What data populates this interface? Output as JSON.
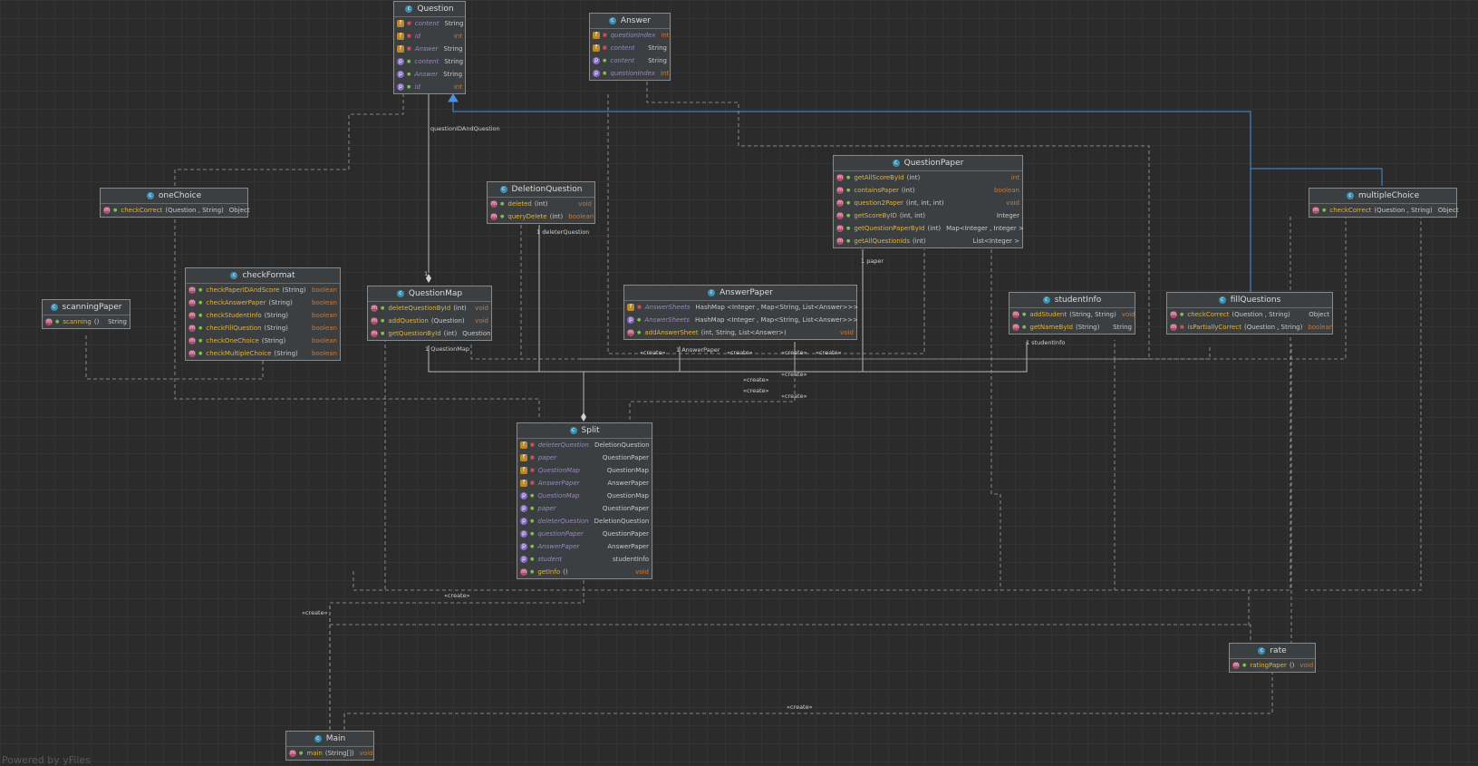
{
  "classes": {
    "question": {
      "name": "Question",
      "members": [
        {
          "kind": "f",
          "vis": "priv",
          "name": "content",
          "type": "String"
        },
        {
          "kind": "f",
          "vis": "priv",
          "name": "id",
          "type": "int"
        },
        {
          "kind": "f",
          "vis": "priv",
          "name": "Answer",
          "type": "String"
        },
        {
          "kind": "p",
          "vis": "pub",
          "name": "content",
          "type": "String"
        },
        {
          "kind": "p",
          "vis": "pub",
          "name": "Answer",
          "type": "String"
        },
        {
          "kind": "p",
          "vis": "pub",
          "name": "id",
          "type": "int"
        }
      ]
    },
    "answer": {
      "name": "Answer",
      "members": [
        {
          "kind": "f",
          "vis": "priv",
          "name": "questionIndex",
          "type": "int"
        },
        {
          "kind": "f",
          "vis": "priv",
          "name": "content",
          "type": "String"
        },
        {
          "kind": "p",
          "vis": "pub",
          "name": "content",
          "type": "String"
        },
        {
          "kind": "p",
          "vis": "pub",
          "name": "questionIndex",
          "type": "int"
        }
      ]
    },
    "onechoice": {
      "name": "oneChoice",
      "members": [
        {
          "kind": "m",
          "vis": "pub",
          "name": "checkCorrect",
          "params": "(Question , String)",
          "type": "Object"
        }
      ]
    },
    "multiplechoice": {
      "name": "multipleChoice",
      "members": [
        {
          "kind": "m",
          "vis": "pub",
          "name": "checkCorrect",
          "params": "(Question , String)",
          "type": "Object"
        }
      ]
    },
    "deletionquestion": {
      "name": "DeletionQuestion",
      "members": [
        {
          "kind": "m",
          "vis": "pub",
          "name": "deleted",
          "params": "(int)",
          "type": "void"
        },
        {
          "kind": "m",
          "vis": "pub",
          "name": "queryDelete",
          "params": "(int)",
          "type": "boolean"
        }
      ]
    },
    "questionpaper": {
      "name": "QuestionPaper",
      "members": [
        {
          "kind": "m",
          "vis": "pub",
          "name": "getAllScoreById",
          "params": "(int)",
          "type": "int"
        },
        {
          "kind": "m",
          "vis": "pub",
          "name": "containsPaper",
          "params": "(int)",
          "type": "boolean"
        },
        {
          "kind": "m",
          "vis": "pub",
          "name": "question2Paper",
          "params": "(int, int, int)",
          "type": "void"
        },
        {
          "kind": "m",
          "vis": "pub",
          "name": "getScoreByID",
          "params": "(int, int)",
          "type": "Integer"
        },
        {
          "kind": "m",
          "vis": "pub",
          "name": "getQuestionPaperById",
          "params": "(int)",
          "type": "Map<Integer , Integer >"
        },
        {
          "kind": "m",
          "vis": "pub",
          "name": "getAllQuestionIds",
          "params": "(int)",
          "type": "List<Integer >"
        }
      ]
    },
    "scanningpaper": {
      "name": "scanningPaper",
      "members": [
        {
          "kind": "m",
          "vis": "pub",
          "name": "scanning",
          "params": "()",
          "type": "String"
        }
      ]
    },
    "checkformat": {
      "name": "checkFormat",
      "members": [
        {
          "kind": "m",
          "vis": "pub",
          "name": "checkPaperIDAndScore",
          "params": "(String)",
          "type": "boolean"
        },
        {
          "kind": "m",
          "vis": "pub",
          "name": "checkAnswerPaper",
          "params": "(String)",
          "type": "boolean"
        },
        {
          "kind": "m",
          "vis": "pub",
          "name": "checkStudentInfo",
          "params": "(String)",
          "type": "boolean"
        },
        {
          "kind": "m",
          "vis": "pub",
          "name": "checkFillQuestion",
          "params": "(String)",
          "type": "boolean"
        },
        {
          "kind": "m",
          "vis": "pub",
          "name": "checkOneChoice",
          "params": "(String)",
          "type": "boolean"
        },
        {
          "kind": "m",
          "vis": "pub",
          "name": "checkMultipleChoice",
          "params": "(String)",
          "type": "boolean"
        }
      ]
    },
    "questionmap": {
      "name": "QuestionMap",
      "members": [
        {
          "kind": "m",
          "vis": "pub",
          "name": "deleteQuestionById",
          "params": "(int)",
          "type": "void"
        },
        {
          "kind": "m",
          "vis": "pub",
          "name": "addQuestion",
          "params": "(Question)",
          "type": "void"
        },
        {
          "kind": "m",
          "vis": "pub",
          "name": "getQuestionById",
          "params": "(int)",
          "type": "Question"
        }
      ]
    },
    "answerpaper": {
      "name": "AnswerPaper",
      "members": [
        {
          "kind": "f",
          "vis": "priv",
          "name": "AnswerSheets",
          "params": "",
          "type": "HashMap <Integer , Map<String, List<Answer>>>"
        },
        {
          "kind": "p",
          "vis": "pub",
          "name": "AnswerSheets",
          "params": "",
          "type": "HashMap <Integer , Map<String, List<Answer>>>"
        },
        {
          "kind": "m",
          "vis": "pub",
          "name": "addAnswerSheet",
          "params": "(int, String, List<Answer>)",
          "type": "void"
        }
      ]
    },
    "studentinfo": {
      "name": "studentInfo",
      "members": [
        {
          "kind": "m",
          "vis": "pub",
          "name": "addStudent",
          "params": "(String, String)",
          "type": "void"
        },
        {
          "kind": "m",
          "vis": "pub",
          "name": "getNameById",
          "params": "(String)",
          "type": "String"
        }
      ]
    },
    "fillquestions": {
      "name": "fillQuestions",
      "members": [
        {
          "kind": "m",
          "vis": "pub",
          "name": "checkCorrect",
          "params": "(Question , String)",
          "type": "Object"
        },
        {
          "kind": "m",
          "vis": "priv",
          "name": "isPartiallyCorrect",
          "params": "(Question , String)",
          "type": "boolean"
        }
      ]
    },
    "split": {
      "name": "Split",
      "members": [
        {
          "kind": "f",
          "vis": "priv",
          "name": "deleterQuestion",
          "type": "DeletionQuestion"
        },
        {
          "kind": "f",
          "vis": "priv",
          "name": "paper",
          "type": "QuestionPaper"
        },
        {
          "kind": "f",
          "vis": "priv",
          "name": "QuestionMap",
          "type": "QuestionMap"
        },
        {
          "kind": "f",
          "vis": "priv",
          "name": "AnswerPaper",
          "type": "AnswerPaper"
        },
        {
          "kind": "p",
          "vis": "pub",
          "name": "QuestionMap",
          "type": "QuestionMap"
        },
        {
          "kind": "p",
          "vis": "pub",
          "name": "paper",
          "type": "QuestionPaper"
        },
        {
          "kind": "p",
          "vis": "pub",
          "name": "deleterQuestion",
          "type": "DeletionQuestion"
        },
        {
          "kind": "p",
          "vis": "pub",
          "name": "questionPaper",
          "type": "QuestionPaper"
        },
        {
          "kind": "p",
          "vis": "pub",
          "name": "AnswerPaper",
          "type": "AnswerPaper"
        },
        {
          "kind": "p",
          "vis": "pub",
          "name": "student",
          "type": "studentInfo"
        },
        {
          "kind": "m",
          "vis": "pub",
          "name": "getInfo",
          "params": "()",
          "type": "void"
        }
      ]
    },
    "rate": {
      "name": "rate",
      "members": [
        {
          "kind": "m",
          "vis": "pub",
          "name": "ratingPaper",
          "params": "()",
          "type": "void"
        }
      ]
    },
    "main": {
      "name": "Main",
      "members": [
        {
          "kind": "m",
          "vis": "pub",
          "name": "main",
          "params": "(String[])",
          "type": "void"
        }
      ]
    }
  },
  "labels": {
    "question_id_and_question": "questionIDAndQuestion",
    "one_qm": "1",
    "deleter_question": "1 deleterQuestion",
    "one_paper": "1 paper",
    "question_map": "1 QuestionMap",
    "answer_paper": "1 AnswerPaper",
    "student_info": "1 studentInfo",
    "create": "«create»"
  },
  "watermark": "Powered by yFiles",
  "colors": {
    "background": "#2b2b2b",
    "box": "#3c3f41",
    "method": "#e0b33d",
    "keyword": "#cc7832",
    "inherit": "#4a8fe0"
  }
}
